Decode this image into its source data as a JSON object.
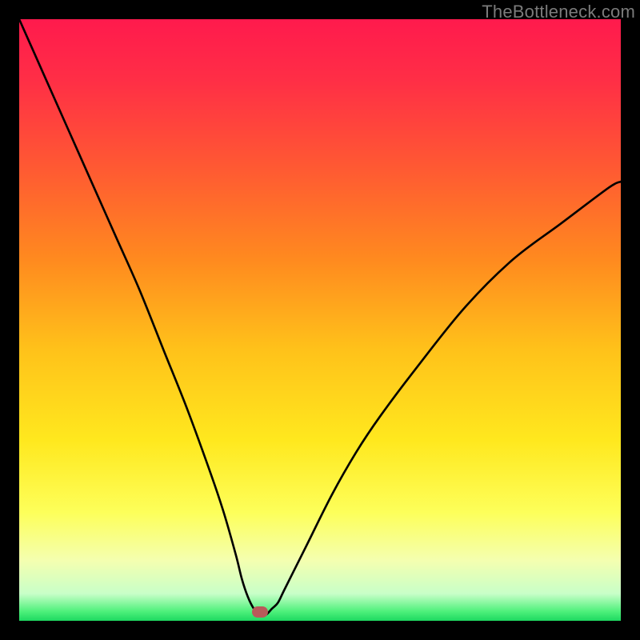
{
  "watermark": {
    "text": "TheBottleneck.com"
  },
  "plot": {
    "inner_left": 24,
    "inner_top": 24,
    "inner_size": 752,
    "gradient_stops": [
      {
        "offset": 0.0,
        "color": "#ff1a4d"
      },
      {
        "offset": 0.1,
        "color": "#ff2e46"
      },
      {
        "offset": 0.25,
        "color": "#ff5a32"
      },
      {
        "offset": 0.4,
        "color": "#ff8a1f"
      },
      {
        "offset": 0.55,
        "color": "#ffc21a"
      },
      {
        "offset": 0.7,
        "color": "#ffe81e"
      },
      {
        "offset": 0.82,
        "color": "#fdff5a"
      },
      {
        "offset": 0.9,
        "color": "#f4ffb0"
      },
      {
        "offset": 0.955,
        "color": "#c8ffc8"
      },
      {
        "offset": 0.985,
        "color": "#4cf07a"
      },
      {
        "offset": 1.0,
        "color": "#1ed860"
      }
    ],
    "marker": {
      "x_pct": 0.4,
      "y_pct": 0.985,
      "color": "#b95a5a"
    }
  },
  "chart_data": {
    "type": "line",
    "title": "",
    "xlabel": "",
    "ylabel": "",
    "xlim": [
      0,
      100
    ],
    "ylim": [
      0,
      100
    ],
    "series": [
      {
        "name": "bottleneck-curve",
        "x": [
          0,
          4,
          8,
          12,
          16,
          20,
          24,
          28,
          32,
          34,
          36,
          37,
          38,
          39,
          40,
          41,
          42,
          43,
          44,
          46,
          48,
          52,
          56,
          60,
          66,
          74,
          82,
          90,
          98,
          100
        ],
        "y": [
          100,
          91,
          82,
          73,
          64,
          55,
          45,
          35,
          24,
          18,
          11,
          7,
          4,
          2,
          1,
          1,
          2,
          3,
          5,
          9,
          13,
          21,
          28,
          34,
          42,
          52,
          60,
          66,
          72,
          73
        ]
      }
    ],
    "annotations": [
      {
        "type": "marker",
        "x": 40,
        "y": 1.5,
        "label": "optimal-point"
      }
    ]
  }
}
